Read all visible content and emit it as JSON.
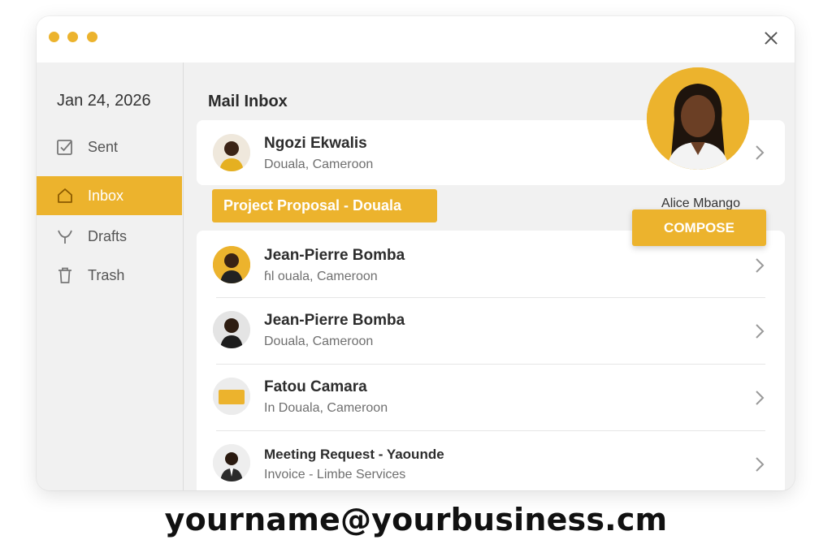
{
  "window": {
    "close_icon": "close-icon"
  },
  "sidebar": {
    "date": "Jan 24, 2026",
    "items": [
      {
        "label": "Sent",
        "icon": "sent-check-icon",
        "active": false
      },
      {
        "label": "Inbox",
        "icon": "home-icon",
        "active": true
      },
      {
        "label": "Drafts",
        "icon": "drafts-icon",
        "active": false
      },
      {
        "label": "Trash",
        "icon": "trash-icon",
        "active": false
      }
    ]
  },
  "main": {
    "title": "Mail Inbox",
    "top_message": {
      "name": "Ngozi Ekwalis",
      "sub": "Douala, Cameroon"
    },
    "subject_tag": "Project Proposal - Douala",
    "messages": [
      {
        "name": "Jean-Pierre Bomba",
        "sub": "ɦl ouala, Cameroon"
      },
      {
        "name": "Jean-Pierre Bomba",
        "sub": "Douala, Cameroon"
      },
      {
        "name": "Fatou Camara",
        "sub": "In Douala, Cameroon"
      },
      {
        "name": "Meeting Request - Yaounde",
        "sub": "Invoice - Limbe Services"
      }
    ]
  },
  "profile": {
    "name": "Alice Mbango"
  },
  "compose": {
    "label": "COMPOSE"
  },
  "footer": {
    "email": "yourname@yourbusiness.cm"
  },
  "colors": {
    "accent": "#ecb32d",
    "background": "#f1f1f1",
    "card": "#ffffff"
  }
}
